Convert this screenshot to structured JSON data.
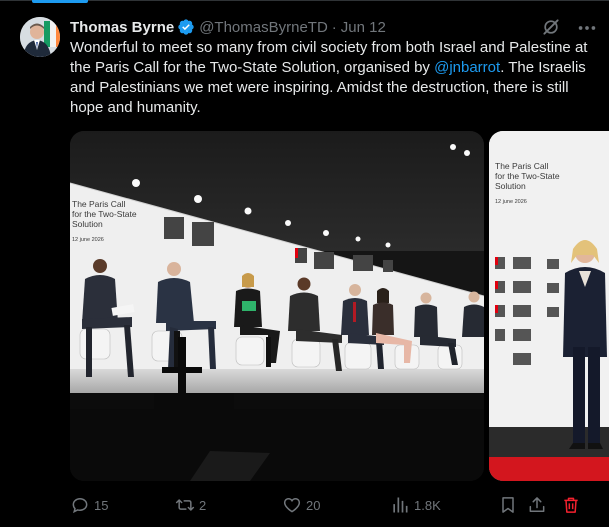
{
  "tweet": {
    "author_name": "Thomas Byrne",
    "handle": "@ThomasByrneTD",
    "separator": "·",
    "date": "Jun 12",
    "text_part1": "Wonderful to meet so many from civil society from both Israel and Palestine at the Paris Call for the Two-State Solution, organised by ",
    "mention": "@jnbarrot",
    "text_part2": ".  The Israelis and Palestinians we met were inspiring.   Amidst the destruction, there is still hope and humanity."
  },
  "media": {
    "photo1_banner": [
      "The Paris Call",
      "for the Two-State",
      "Solution"
    ],
    "photo1_date": "12 june 2026",
    "photo2_banner": [
      "The Paris Call",
      "for the Two-State",
      "Solution"
    ],
    "photo2_date": "12 june 2026"
  },
  "actions": {
    "replies": "15",
    "reposts": "2",
    "likes": "20",
    "views": "1.8K"
  },
  "colors": {
    "background": "#000000",
    "text": "#e7e9ea",
    "muted": "#71767b",
    "accent": "#1d9bf0",
    "delete": "#f4212e"
  },
  "icons": [
    "verified-badge-icon",
    "grok-icon",
    "more-icon",
    "reply-icon",
    "repost-icon",
    "like-icon",
    "views-icon",
    "bookmark-icon",
    "share-icon",
    "delete-icon"
  ]
}
